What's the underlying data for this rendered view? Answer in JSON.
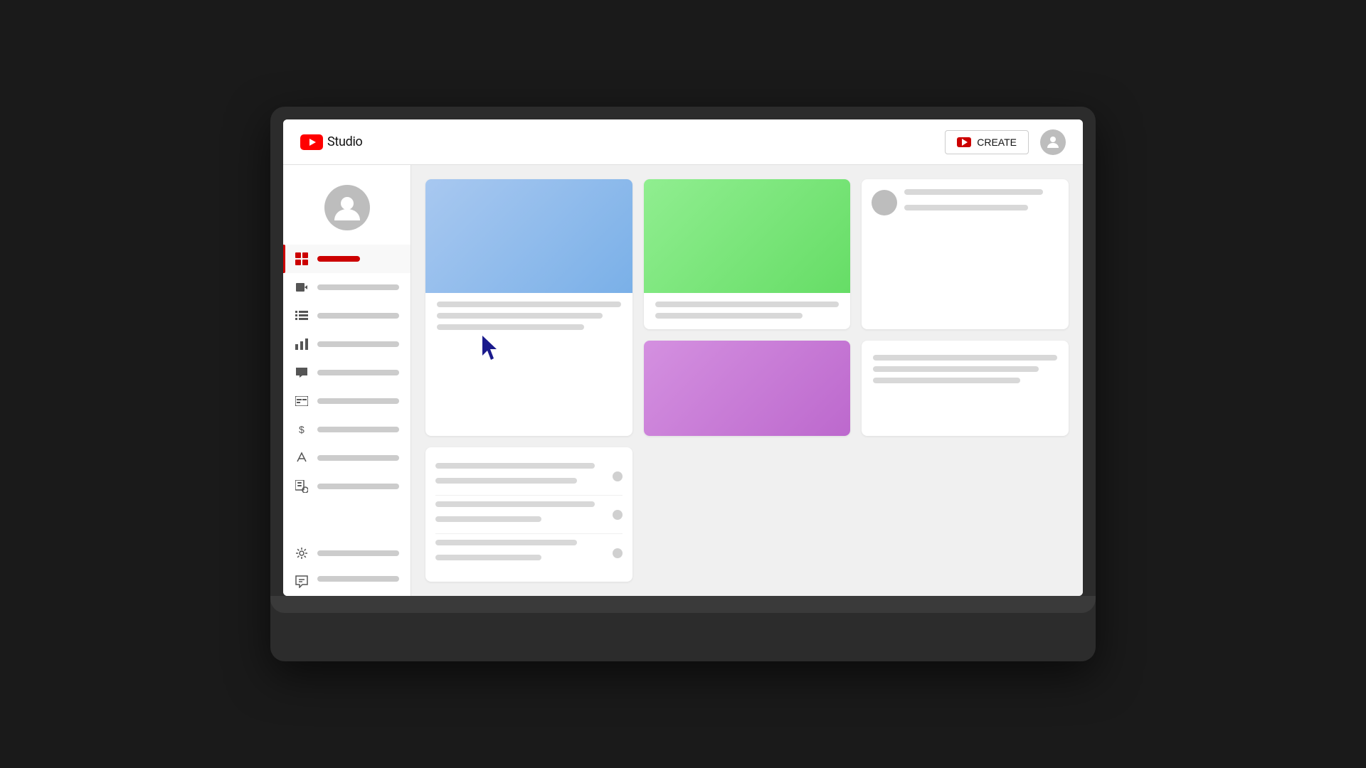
{
  "header": {
    "logo_text": "Studio",
    "create_button_label": "CREATE",
    "avatar_alt": "User avatar"
  },
  "sidebar": {
    "items": [
      {
        "id": "dashboard",
        "icon": "grid-icon",
        "label": "",
        "active": true
      },
      {
        "id": "content",
        "icon": "video-icon",
        "label": ""
      },
      {
        "id": "playlists",
        "icon": "list-icon",
        "label": ""
      },
      {
        "id": "analytics",
        "icon": "bar-chart-icon",
        "label": ""
      },
      {
        "id": "comments",
        "icon": "comment-icon",
        "label": ""
      },
      {
        "id": "subtitles",
        "icon": "subtitles-icon",
        "label": ""
      },
      {
        "id": "monetization",
        "icon": "dollar-icon",
        "label": ""
      },
      {
        "id": "customization",
        "icon": "brush-icon",
        "label": ""
      },
      {
        "id": "audio-library",
        "icon": "audio-icon",
        "label": ""
      }
    ],
    "bottom_items": [
      {
        "id": "settings",
        "icon": "gear-icon",
        "label": ""
      },
      {
        "id": "feedback",
        "icon": "feedback-icon",
        "label": ""
      }
    ]
  },
  "cards": {
    "card1": {
      "thumbnail_color": "blue",
      "lines": [
        "full",
        "long",
        "medium",
        "short"
      ]
    },
    "card2": {
      "thumbnail_color": "green",
      "lines": [
        "full",
        "medium"
      ]
    },
    "card3": {
      "thumbnail_color": "purple",
      "lines": [
        "full",
        "medium",
        "short"
      ]
    },
    "card4": {
      "lines": [
        "full",
        "medium",
        "short"
      ]
    },
    "right_panel": {
      "rows": [
        {
          "line1": "long",
          "line2": "medium"
        },
        {
          "line1": "long",
          "line2": "short"
        },
        {
          "line1": "medium",
          "line2": "short"
        }
      ]
    }
  },
  "colors": {
    "youtube_red": "#cc0000",
    "active_indicator": "#cc0000",
    "blue_thumb": "#90c0f0",
    "green_thumb": "#78ee78",
    "purple_thumb": "#cc77dd"
  }
}
